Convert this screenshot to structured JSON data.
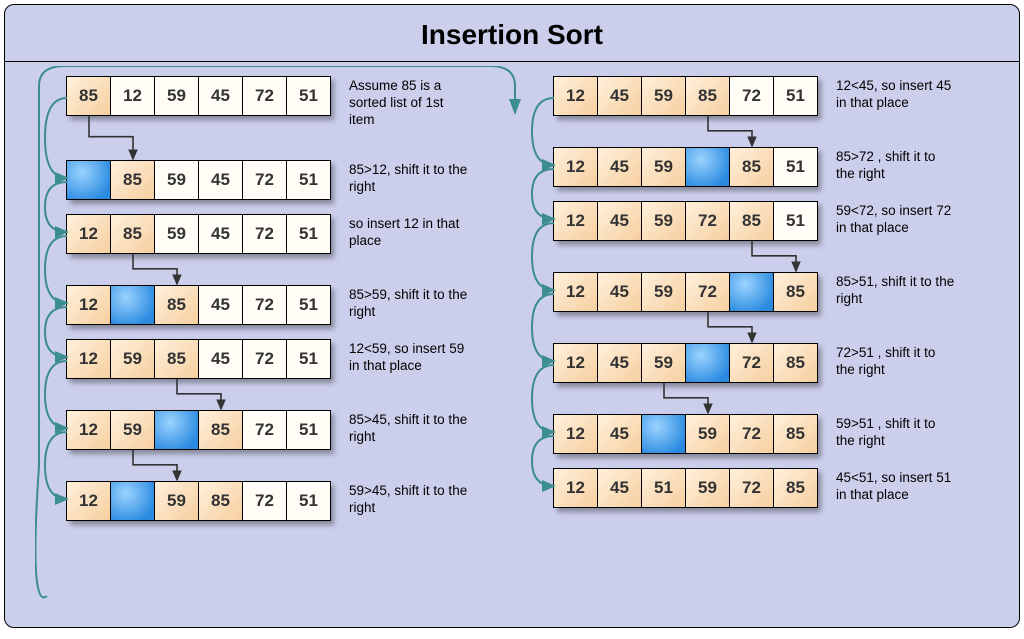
{
  "title": "Insertion  Sort",
  "colors": {
    "background": "#cccfec",
    "sorted": "#f6cfa0",
    "active": "#2a8ae0",
    "unsorted": "#fffdf5",
    "flowArrow": "#3c8e8e",
    "shiftArrow": "#333333"
  },
  "left": [
    {
      "cells": [
        "85",
        "12",
        "59",
        "45",
        "72",
        "51"
      ],
      "sorted": [
        0
      ],
      "active": -1,
      "caption": "Assume 85 is a sorted list of 1st item",
      "tight": false,
      "shift": {
        "from": 0,
        "to": 1
      }
    },
    {
      "cells": [
        "",
        "85",
        "59",
        "45",
        "72",
        "51"
      ],
      "sorted": [
        1
      ],
      "active": 0,
      "caption": "85>12, shift it to the right",
      "tight": true,
      "shift": null
    },
    {
      "cells": [
        "12",
        "85",
        "59",
        "45",
        "72",
        "51"
      ],
      "sorted": [
        0,
        1
      ],
      "active": -1,
      "caption": "so insert 12 in that place",
      "tight": false,
      "shift": {
        "from": 1,
        "to": 2
      }
    },
    {
      "cells": [
        "12",
        "",
        "85",
        "45",
        "72",
        "51"
      ],
      "sorted": [
        0,
        2
      ],
      "active": 1,
      "caption": "85>59, shift it to the right",
      "tight": true,
      "shift": null
    },
    {
      "cells": [
        "12",
        "59",
        "85",
        "45",
        "72",
        "51"
      ],
      "sorted": [
        0,
        1,
        2
      ],
      "active": -1,
      "caption": "12<59, so insert 59 in that place",
      "tight": false,
      "shift": {
        "from": 2,
        "to": 3
      }
    },
    {
      "cells": [
        "12",
        "59",
        "",
        "85",
        "72",
        "51"
      ],
      "sorted": [
        0,
        1,
        3
      ],
      "active": 2,
      "caption": "85>45, shift it to the right",
      "tight": false,
      "shift": {
        "from": 1,
        "to": 2
      }
    },
    {
      "cells": [
        "12",
        "",
        "59",
        "85",
        "72",
        "51"
      ],
      "sorted": [
        0,
        2,
        3
      ],
      "active": 1,
      "caption": "59>45, shift it to the right",
      "tight": false,
      "shift": null
    }
  ],
  "right": [
    {
      "cells": [
        "12",
        "45",
        "59",
        "85",
        "72",
        "51"
      ],
      "sorted": [
        0,
        1,
        2,
        3
      ],
      "active": -1,
      "caption": "12<45, so insert 45 in that place",
      "tight": false,
      "shift": {
        "from": 3,
        "to": 4
      }
    },
    {
      "cells": [
        "12",
        "45",
        "59",
        "",
        "85",
        "51"
      ],
      "sorted": [
        0,
        1,
        2,
        4
      ],
      "active": 3,
      "caption": "85>72 , shift it to the right",
      "tight": true,
      "shift": null
    },
    {
      "cells": [
        "12",
        "45",
        "59",
        "72",
        "85",
        "51"
      ],
      "sorted": [
        0,
        1,
        2,
        3,
        4
      ],
      "active": -1,
      "caption": "59<72, so insert 72 in that place",
      "tight": false,
      "shift": {
        "from": 4,
        "to": 5
      }
    },
    {
      "cells": [
        "12",
        "45",
        "59",
        "72",
        "",
        "85"
      ],
      "sorted": [
        0,
        1,
        2,
        3,
        5
      ],
      "active": 4,
      "caption": "85>51, shift it to the right",
      "tight": false,
      "shift": {
        "from": 3,
        "to": 4
      }
    },
    {
      "cells": [
        "12",
        "45",
        "59",
        "",
        "72",
        "85"
      ],
      "sorted": [
        0,
        1,
        2,
        4,
        5
      ],
      "active": 3,
      "caption": "72>51 , shift it to the right",
      "tight": false,
      "shift": {
        "from": 2,
        "to": 3
      }
    },
    {
      "cells": [
        "12",
        "45",
        "",
        "59",
        "72",
        "85"
      ],
      "sorted": [
        0,
        1,
        3,
        4,
        5
      ],
      "active": 2,
      "caption": "59>51 , shift it to the right",
      "tight": true,
      "shift": null
    },
    {
      "cells": [
        "12",
        "45",
        "51",
        "59",
        "72",
        "85"
      ],
      "sorted": [
        0,
        1,
        2,
        3,
        4,
        5
      ],
      "active": -1,
      "caption": "45<51, so insert 51 in that place",
      "tight": false,
      "shift": null
    }
  ]
}
